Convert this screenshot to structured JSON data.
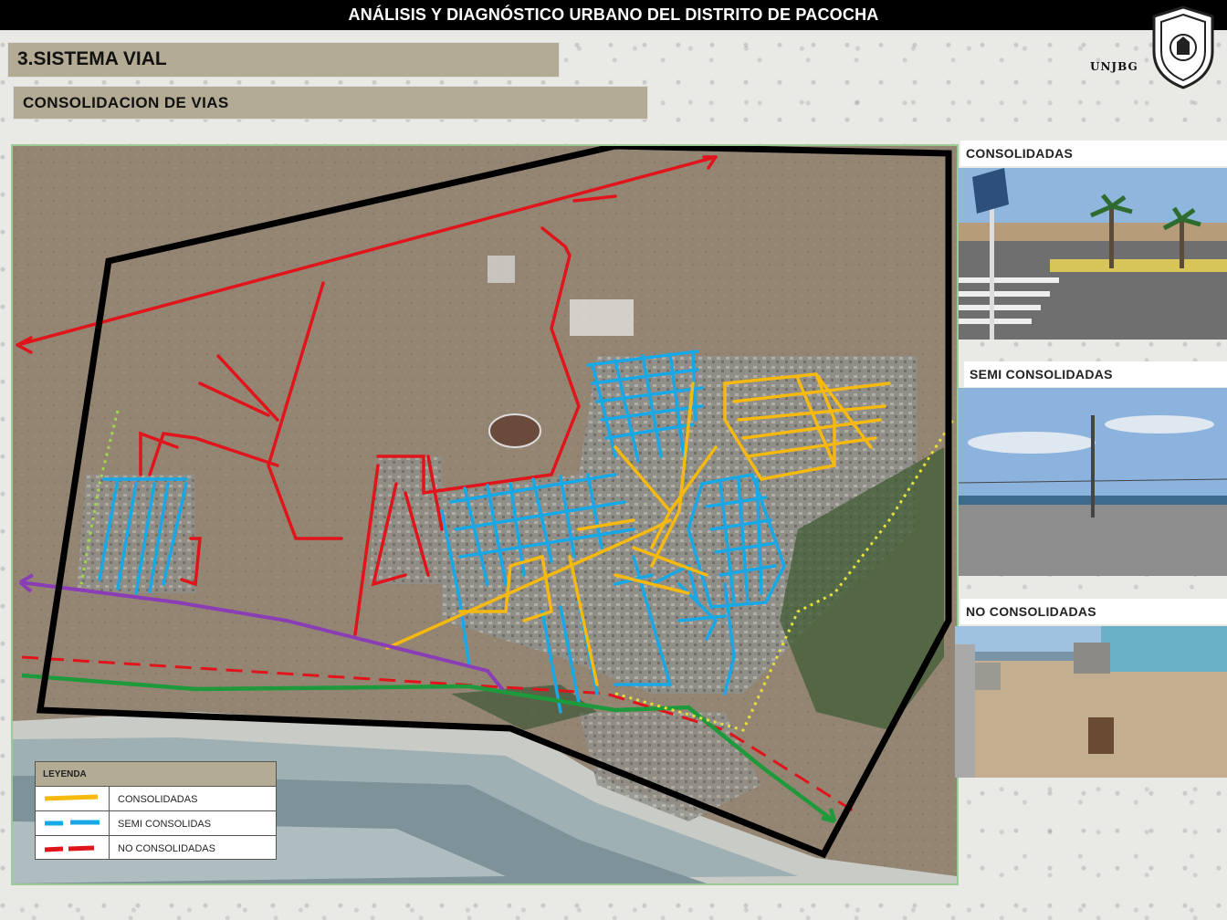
{
  "header": {
    "title": "ANÁLISIS Y DIAGNÓSTICO URBANO DEL DISTRITO DE PACOCHA"
  },
  "section": {
    "title": "3.SISTEMA  VIAL"
  },
  "subsection": {
    "title": "CONSOLIDACION DE VIAS"
  },
  "logo": {
    "text": "UNJBG",
    "icon": "university-seal-icon"
  },
  "legend": {
    "title": "LEYENDA",
    "items": [
      {
        "label": "CONSOLIDADAS",
        "color": "#f5b90f"
      },
      {
        "label": "SEMI CONSOLIDAS",
        "color": "#18a8e6"
      },
      {
        "label": "NO CONSOLIDADAS",
        "color": "#e0141b"
      }
    ]
  },
  "photos": [
    {
      "label": "CONSOLIDADAS"
    },
    {
      "label": "SEMI CONSOLIDADAS"
    },
    {
      "label": "NO CONSOLIDADAS"
    }
  ],
  "colors": {
    "consolidadas": "#f5b90f",
    "semi": "#18a8e6",
    "no": "#e0141b",
    "boundary": "#000000",
    "purple_road": "#8a3db5",
    "green_road": "#1e9a3c",
    "yellow_dotted": "#e8e03a",
    "green_dotted": "#9fd84a"
  }
}
